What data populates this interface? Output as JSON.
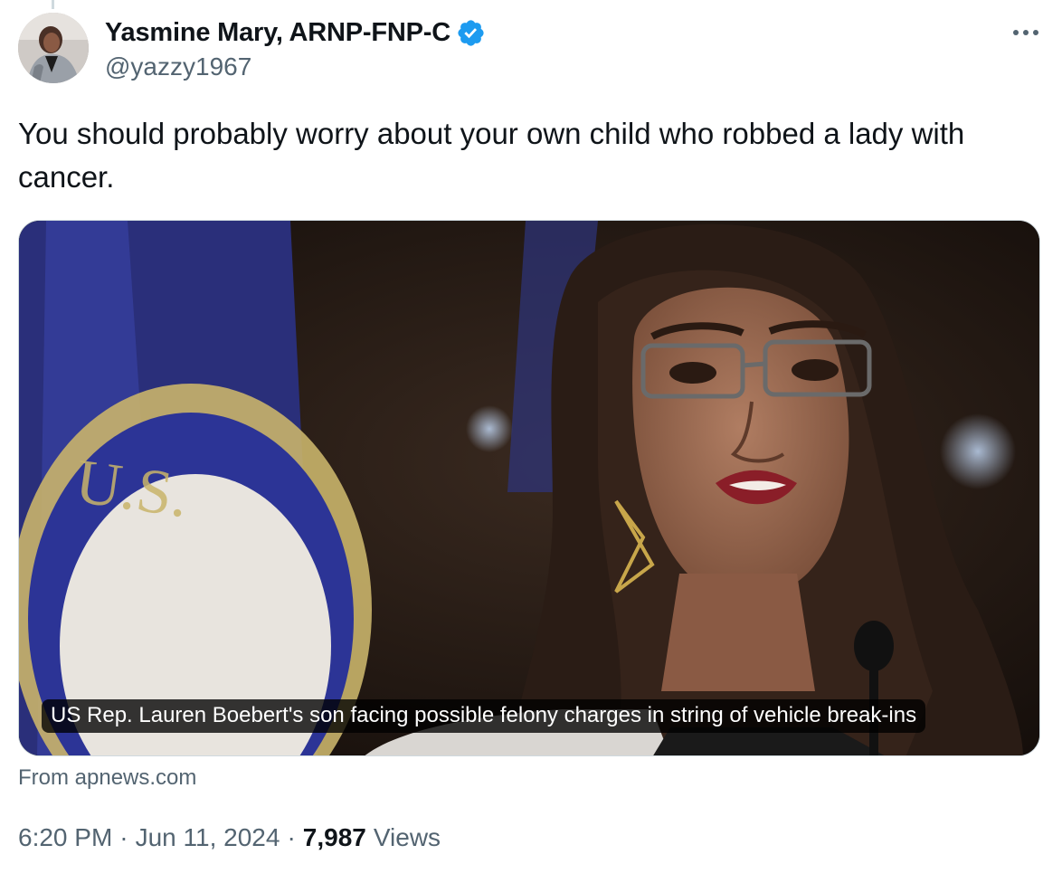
{
  "author": {
    "display_name": "Yasmine Mary, ARNP-FNP-C",
    "handle": "@yazzy1967",
    "verified": true
  },
  "tweet": {
    "text": "You should probably worry about your own child who robbed a lady with cancer."
  },
  "link_card": {
    "headline": "US Rep. Lauren Boebert's son facing possible felony charges in string of vehicle break-ins",
    "source": "From apnews.com"
  },
  "meta": {
    "time": "6:20 PM",
    "separator": "·",
    "date": "Jun 11, 2024",
    "views_count": "7,987",
    "views_label": "Views"
  },
  "colors": {
    "text_primary": "#0f1419",
    "text_secondary": "#536471",
    "verified_blue": "#1d9bf0",
    "border": "#cfd9de"
  }
}
